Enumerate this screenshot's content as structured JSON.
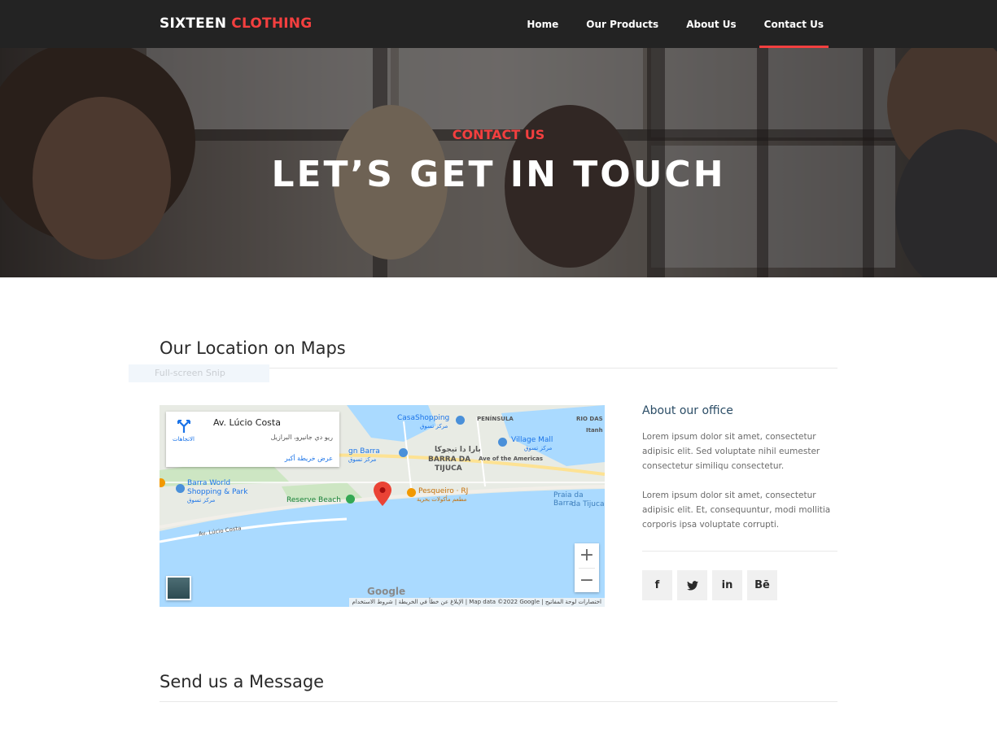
{
  "header": {
    "logo_main": "SIXTEEN",
    "logo_accent": "CLOTHING",
    "nav": [
      {
        "label": "Home",
        "active": false
      },
      {
        "label": "Our Products",
        "active": false
      },
      {
        "label": "About Us",
        "active": false
      },
      {
        "label": "Contact Us",
        "active": true
      }
    ]
  },
  "hero": {
    "subtitle": "CONTACT US",
    "title": "LET’S GET IN TOUCH"
  },
  "location": {
    "title": "Our Location on Maps",
    "snip_tip": "Full-screen Snip"
  },
  "map": {
    "info_title": "Av. Lúcio Costa",
    "info_address": "ريو دي جانيرو، البرازيل",
    "info_directions": "الاتجاهات",
    "info_link": "عرض خريطة أكبر",
    "labels": {
      "casashopping": "CasaShopping",
      "casashopping_ar": "مركز تسوق",
      "peninsula": "PENÍNSULA",
      "rio_das": "RIO DAS",
      "itanh": "Itanh",
      "village_mall": "Village Mall",
      "village_mall_ar": "مركز تسوق",
      "gn_barra": "gn Barra",
      "gn_barra_ar": "مركز تسوق",
      "barra_tijuca_ar": "بارا دا تيجوكا",
      "barra_da": "BARRA DA",
      "tijuca": "TIJUCA",
      "ave_americas": "Ave of the Americas",
      "barra_world": "Barra World",
      "shopping_park": "Shopping & Park",
      "barra_world_ar": "مركز تسوق",
      "reserve_beach": "Reserve Beach",
      "pesqueiro": "Pesqueiro · RJ",
      "pesqueiro_ar": "مطعم مأكولات بحرية",
      "praia_barra": "Praia da Barra",
      "da_tijuca": "da Tijuca",
      "av_lucio": "Av. Lúcio Costa"
    },
    "zoom_in": "+",
    "zoom_out": "−",
    "google": "Google",
    "attribution": "الإبلاغ عن خطأ في الخريطة | شروط الاستخدام | Map data ©2022 Google | اختصارات لوحة المفاتيح"
  },
  "office": {
    "title": "About our office",
    "paragraph1": "Lorem ipsum dolor sit amet, consectetur adipisic elit. Sed voluptate nihil eumester consectetur similiqu consectetur.",
    "paragraph2": "Lorem ipsum dolor sit amet, consectetur adipisic elit. Et, consequuntur, modi mollitia corporis ipsa voluptate corrupti.",
    "social": [
      {
        "name": "facebook",
        "glyph": "f"
      },
      {
        "name": "twitter",
        "glyph": "🐦"
      },
      {
        "name": "linkedin",
        "glyph": "in"
      },
      {
        "name": "behance",
        "glyph": "Bē"
      }
    ]
  },
  "message": {
    "title": "Send us a Message"
  },
  "colors": {
    "accent": "#f33f3f",
    "header_bg": "#232323",
    "office_title": "#2b4d66"
  }
}
